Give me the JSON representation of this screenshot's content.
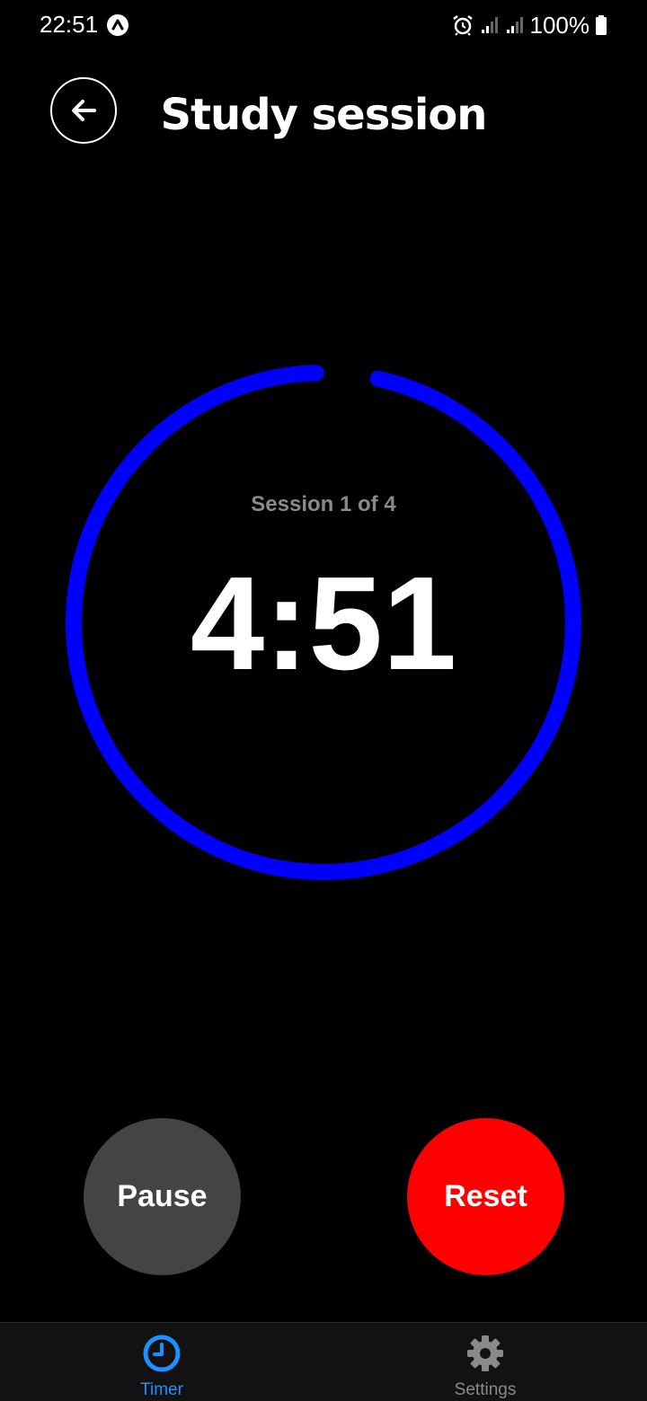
{
  "status_bar": {
    "time": "22:51",
    "battery": "100%",
    "icons": [
      "app-notification-icon",
      "alarm-icon",
      "signal-icon",
      "signal-icon",
      "battery-icon"
    ]
  },
  "header": {
    "title": "Study session",
    "back_icon": "arrow-left-icon"
  },
  "timer": {
    "session_label": "Session 1 of 4",
    "time_remaining": "4:51",
    "progress_fraction": 0.97,
    "ring_color": "#0000ff"
  },
  "controls": {
    "pause_label": "Pause",
    "reset_label": "Reset",
    "pause_color": "#444444",
    "reset_color": "#ff0000"
  },
  "bottom_nav": {
    "tabs": [
      {
        "label": "Timer",
        "icon": "clock-icon",
        "active": true,
        "color": "#1e90ff"
      },
      {
        "label": "Settings",
        "icon": "gear-icon",
        "active": false,
        "color": "#8a8a8a"
      }
    ]
  }
}
